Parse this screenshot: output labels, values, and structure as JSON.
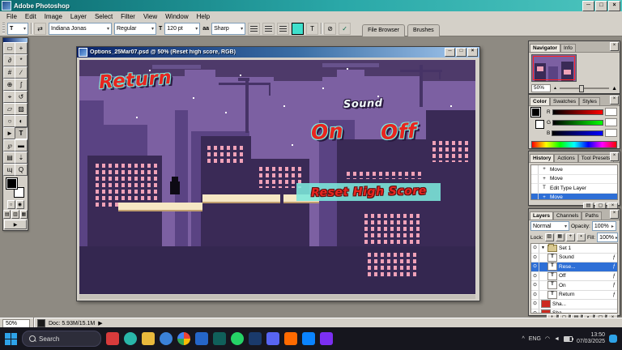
{
  "app": {
    "title": "Adobe Photoshop"
  },
  "icons": {
    "minimize": "─",
    "maximize": "□",
    "close": "×",
    "dropdown": "▾",
    "dropdown_small": "▸",
    "check": "✓",
    "cancel": "⊘",
    "eye": "⊙",
    "expand": "▼",
    "triangle": "▲",
    "fx": "ƒ",
    "mask": "◻",
    "new_set": "▤",
    "adjustment": "◐",
    "new_layer": "▢",
    "trash": "×",
    "lock_transparency": "▨",
    "lock_image": "▦",
    "lock_position": "+",
    "lock_all": "▪",
    "orientation": "⇄",
    "aa": "aa",
    "play": "▶",
    "chevron_up": "^",
    "wifi": "◠",
    "speaker": "◄",
    "type": "T",
    "move": "+"
  },
  "menu": {
    "items": [
      "File",
      "Edit",
      "Image",
      "Layer",
      "Select",
      "Filter",
      "View",
      "Window",
      "Help"
    ]
  },
  "options": {
    "tool_preset": "T",
    "font_family": "Indiana Jonas",
    "font_style": "Regular",
    "font_size": "120 pt",
    "anti_alias": "Sharp",
    "dock_tabs": [
      "File Browser",
      "Brushes"
    ]
  },
  "toolbar": {
    "tools": [
      {
        "name": "rectangular-marquee",
        "glyph": "▭"
      },
      {
        "name": "move",
        "glyph": "+"
      },
      {
        "name": "lasso",
        "glyph": "∂"
      },
      {
        "name": "magic-wand",
        "glyph": "*"
      },
      {
        "name": "crop",
        "glyph": "#"
      },
      {
        "name": "slice",
        "glyph": "∕"
      },
      {
        "name": "healing-brush",
        "glyph": "⊕"
      },
      {
        "name": "brush",
        "glyph": "ʃ"
      },
      {
        "name": "clone-stamp",
        "glyph": "⌖"
      },
      {
        "name": "history-brush",
        "glyph": "↺"
      },
      {
        "name": "eraser",
        "glyph": "▱"
      },
      {
        "name": "gradient",
        "glyph": "▨"
      },
      {
        "name": "blur",
        "glyph": "○"
      },
      {
        "name": "dodge",
        "glyph": "◐"
      },
      {
        "name": "path-selection",
        "glyph": "►"
      },
      {
        "name": "type",
        "glyph": "T"
      },
      {
        "name": "pen",
        "glyph": "℘"
      },
      {
        "name": "shape",
        "glyph": "▬"
      },
      {
        "name": "notes",
        "glyph": "▤"
      },
      {
        "name": "eyedropper",
        "glyph": "⇣"
      },
      {
        "name": "hand",
        "glyph": "ɰ"
      },
      {
        "name": "zoom",
        "glyph": "Q"
      }
    ]
  },
  "document": {
    "title": "Options_25Mar07.psd @ 50% (Reset high score, RGB)",
    "canvas_text": {
      "return_btn": "Return",
      "sound": "Sound",
      "on": "On",
      "off": "Off",
      "reset": "Reset High Score"
    }
  },
  "panels": {
    "navigator": {
      "tabs": [
        "Navigator",
        "Info"
      ],
      "zoom": "50%"
    },
    "color": {
      "tabs": [
        "Color",
        "Swatches",
        "Styles"
      ],
      "channels": [
        "R",
        "G",
        "B"
      ]
    },
    "history": {
      "tabs": [
        "History",
        "Actions",
        "Tool Presets"
      ],
      "items": [
        {
          "label": "Move",
          "glyph": "+"
        },
        {
          "label": "Move",
          "glyph": "+"
        },
        {
          "label": "Edit Type Layer",
          "glyph": "T"
        },
        {
          "label": "Move",
          "glyph": "+"
        }
      ]
    },
    "layers": {
      "tabs": [
        "Layers",
        "Channels",
        "Paths"
      ],
      "blend_mode": "Normal",
      "opacity_label": "Opacity:",
      "opacity_value": "100%",
      "lock_label": "Lock:",
      "fill_label": "Fill:",
      "fill_value": "100%",
      "items": [
        {
          "name": "Set 1",
          "kind": "group"
        },
        {
          "name": "Sound",
          "kind": "text"
        },
        {
          "name": "Rese...",
          "kind": "text",
          "selected": true
        },
        {
          "name": "Off",
          "kind": "text"
        },
        {
          "name": "On",
          "kind": "text"
        },
        {
          "name": "Return",
          "kind": "text"
        },
        {
          "name": "Sha...",
          "kind": "fill"
        },
        {
          "name": "Sha...",
          "kind": "fill"
        }
      ]
    }
  },
  "status": {
    "zoom": "50%",
    "doc_sizes": "Doc: 5.93M/15.1M"
  },
  "taskbar": {
    "search_label": "Search",
    "lang": "ENG",
    "time": "13:50",
    "date": "07/03/2025"
  },
  "colors": {
    "titlebar_teal": "#1f8f8f",
    "selection_blue": "#2e6fd6",
    "canvas_sky": "#7c60a2",
    "canvas_building_dark": "#3a2a56",
    "canvas_building_mid": "#5a4383",
    "window_pink": "#f0a2b8",
    "platform_cream": "#f6e7c4",
    "game_red": "#e8251f",
    "game_cyan": "#7ce8dc",
    "type_color_swatch": "#3fe0cc"
  }
}
